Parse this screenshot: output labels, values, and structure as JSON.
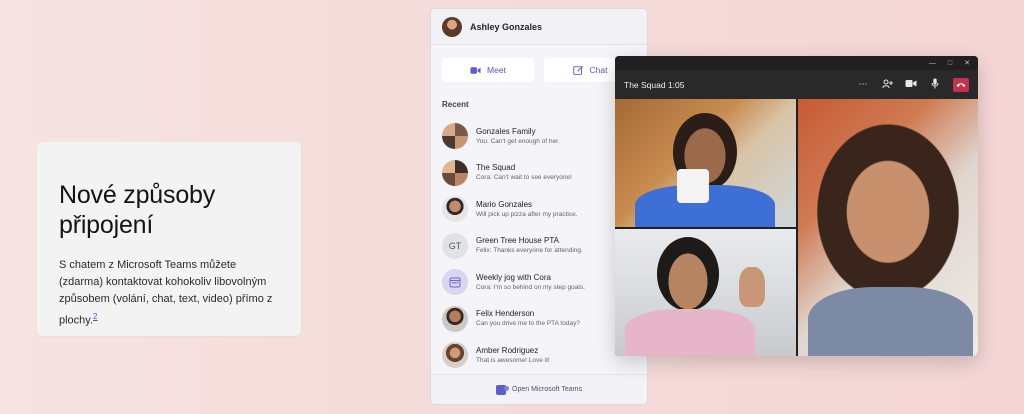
{
  "promo": {
    "title": "Nové způsoby připojení",
    "body": "S chatem z Microsoft Teams můžete (zdarma) kontaktovat kohokoliv libovolným způsobem (volání, chat, text, video) přímo z plochy.",
    "footnote": "2"
  },
  "panel": {
    "user_name": "Ashley Gonzales",
    "meet_label": "Meet",
    "chat_label": "Chat",
    "recent_label": "Recent",
    "chats": [
      {
        "name": "Gonzales Family",
        "preview": "You: Can't get enough of her."
      },
      {
        "name": "The Squad",
        "preview": "Cora: Can't wait to see everyone!"
      },
      {
        "name": "Mario Gonzales",
        "preview": "Will pick up pizza after my practice."
      },
      {
        "name": "Green Tree House PTA",
        "preview": "Felix: Thanks everyone for attending.",
        "initials": "GT"
      },
      {
        "name": "Weekly jog with Cora",
        "preview": "Cora: I'm so behind on my step goals."
      },
      {
        "name": "Felix Henderson",
        "preview": "Can you drive me to the PTA today?"
      },
      {
        "name": "Amber Rodriguez",
        "preview": "That is awesome! Love it!"
      }
    ],
    "footer_label": "Open Microsoft Teams"
  },
  "call": {
    "title": "The Squad 1:05"
  },
  "colors": {
    "accent": "#5b5fc7",
    "hangup": "#c4314b"
  }
}
